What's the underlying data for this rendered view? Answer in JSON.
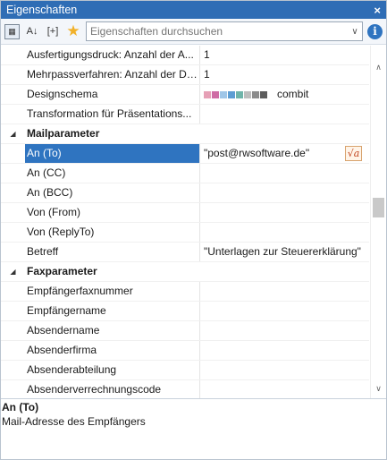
{
  "window": {
    "title": "Eigenschaften",
    "close_glyph": "×"
  },
  "toolbar": {
    "categorized_icon": "categorized-view-icon",
    "sort_icon": "sort-az-icon",
    "expand_label": "[+]",
    "favorite_icon": "star-icon",
    "search_placeholder": "Eigenschaften durchsuchen",
    "info_label": "i"
  },
  "rows_top": [
    {
      "name": "Ausfertigungsdruck: Anzahl der A...",
      "value": "1"
    },
    {
      "name": "Mehrpassverfahren: Anzahl der Du...",
      "value": "1"
    },
    {
      "name": "Designschema",
      "value": "combit"
    },
    {
      "name": "Transformation für Präsentations...",
      "value": ""
    }
  ],
  "swatch_colors": [
    "#e6a0b6",
    "#cf6ca4",
    "#9fc6e8",
    "#5d9dd3",
    "#6fb4a9",
    "#bdbdbd",
    "#8c8c8c",
    "#5d5d5d"
  ],
  "mail": {
    "label": "Mailparameter",
    "rows": [
      {
        "name": "An (To)",
        "value": "\"post@rwsoftware.de\""
      },
      {
        "name": "An (CC)",
        "value": ""
      },
      {
        "name": "An (BCC)",
        "value": ""
      },
      {
        "name": "Von (From)",
        "value": ""
      },
      {
        "name": "Von (ReplyTo)",
        "value": ""
      },
      {
        "name": "Betreff",
        "value": "\"Unterlagen zur Steuererklärung\""
      }
    ],
    "formula_label": "√a"
  },
  "fax": {
    "label": "Faxparameter",
    "rows": [
      {
        "name": "Empfängerfaxnummer",
        "value": ""
      },
      {
        "name": "Empfängername",
        "value": ""
      },
      {
        "name": "Absendername",
        "value": ""
      },
      {
        "name": "Absenderfirma",
        "value": ""
      },
      {
        "name": "Absenderabteilung",
        "value": ""
      },
      {
        "name": "Absenderverrechnungscode",
        "value": ""
      }
    ]
  },
  "description": {
    "title": "An (To)",
    "text": "Mail-Adresse des Empfängers"
  },
  "colors": {
    "accent": "#2f74c0",
    "titlebar": "#2f6db5"
  }
}
